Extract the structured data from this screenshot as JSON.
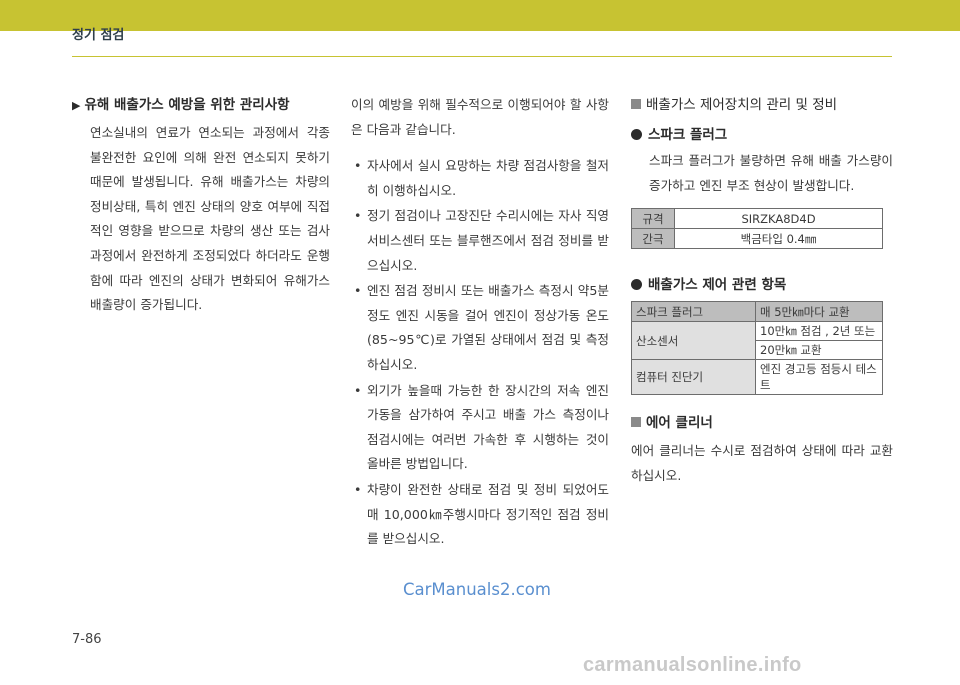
{
  "header": {
    "title": "정기 점검"
  },
  "col1": {
    "heading": "유해 배출가스 예방을 위한 관리사항",
    "paragraph": "연소실내의 연료가 연소되는 과정에서 각종 불완전한 요인에 의해 완전 연소되지 못하기 때문에 발생됩니다. 유해 배출가스는 차량의 정비상태, 특히 엔진 상태의 양호 여부에 직접적인 영향을 받으므로 차량의 생산 또는 검사 과정에서 완전하게 조정되었다 하더라도 운행함에 따라 엔진의 상태가 변화되어 유해가스 배출량이 증가됩니다."
  },
  "col2": {
    "intro": "이의 예방을 위해 필수적으로 이행되어야 할 사항은 다음과 같습니다.",
    "bullets": [
      "자사에서 실시 요망하는 차량 점검사항을 철저히 이행하십시오.",
      "정기 점검이나 고장진단 수리시에는 자사 직영 서비스센터 또는 블루핸즈에서 점검 정비를 받으십시오.",
      "엔진 점검 정비시 또는 배출가스 측정시 약5분정도 엔진 시동을 걸어 엔진이 정상가동 온도(85~95℃)로 가열된 상태에서 점검 및 측정하십시오.",
      "외기가 높을때 가능한 한 장시간의 저속 엔진 가동을 삼가하여 주시고 배출 가스 측정이나 점검시에는 여러번 가속한 후 시행하는 것이 올바른 방법입니다.",
      "차량이 완전한 상태로 점검 및 정비 되었어도 매 10,000㎞주행시마다 정기적인 점검 정비를 받으십시오."
    ]
  },
  "col3": {
    "section_title": "배출가스 제어장치의 관리 및 정비",
    "spark": {
      "heading": "스파크 플러그",
      "text": "스파크 플러그가 불량하면 유해 배출 가스량이 증가하고 엔진 부조 현상이 발생합니다.",
      "table": [
        {
          "label": "규격",
          "value": "SIRZKA8D4D"
        },
        {
          "label": "간극",
          "value": "백금타입 0.4㎜"
        }
      ]
    },
    "control": {
      "heading": "배출가스 제어 관련 항목",
      "table": [
        {
          "label": "스파크 플러그",
          "value_lines": [
            "매 5만㎞마다 교환"
          ]
        },
        {
          "label": "산소센서",
          "value_lines": [
            "10만㎞ 점검 , 2년 또는",
            "20만㎞ 교환"
          ]
        },
        {
          "label": "컴퓨터 진단기",
          "value_lines": [
            "엔진 경고등 점등시 테스트"
          ]
        }
      ]
    },
    "air": {
      "section_title": "에어 클리너",
      "text": "에어 클리너는 수시로 점검하여 상태에 따라 교환하십시오."
    }
  },
  "watermark": "CarManuals2.com",
  "page_number": "7-86",
  "footer_watermark": "carmanualsonline.info",
  "colors": {
    "header_bar": "#c7c332",
    "watermark_blue": "#5a8fcf"
  }
}
